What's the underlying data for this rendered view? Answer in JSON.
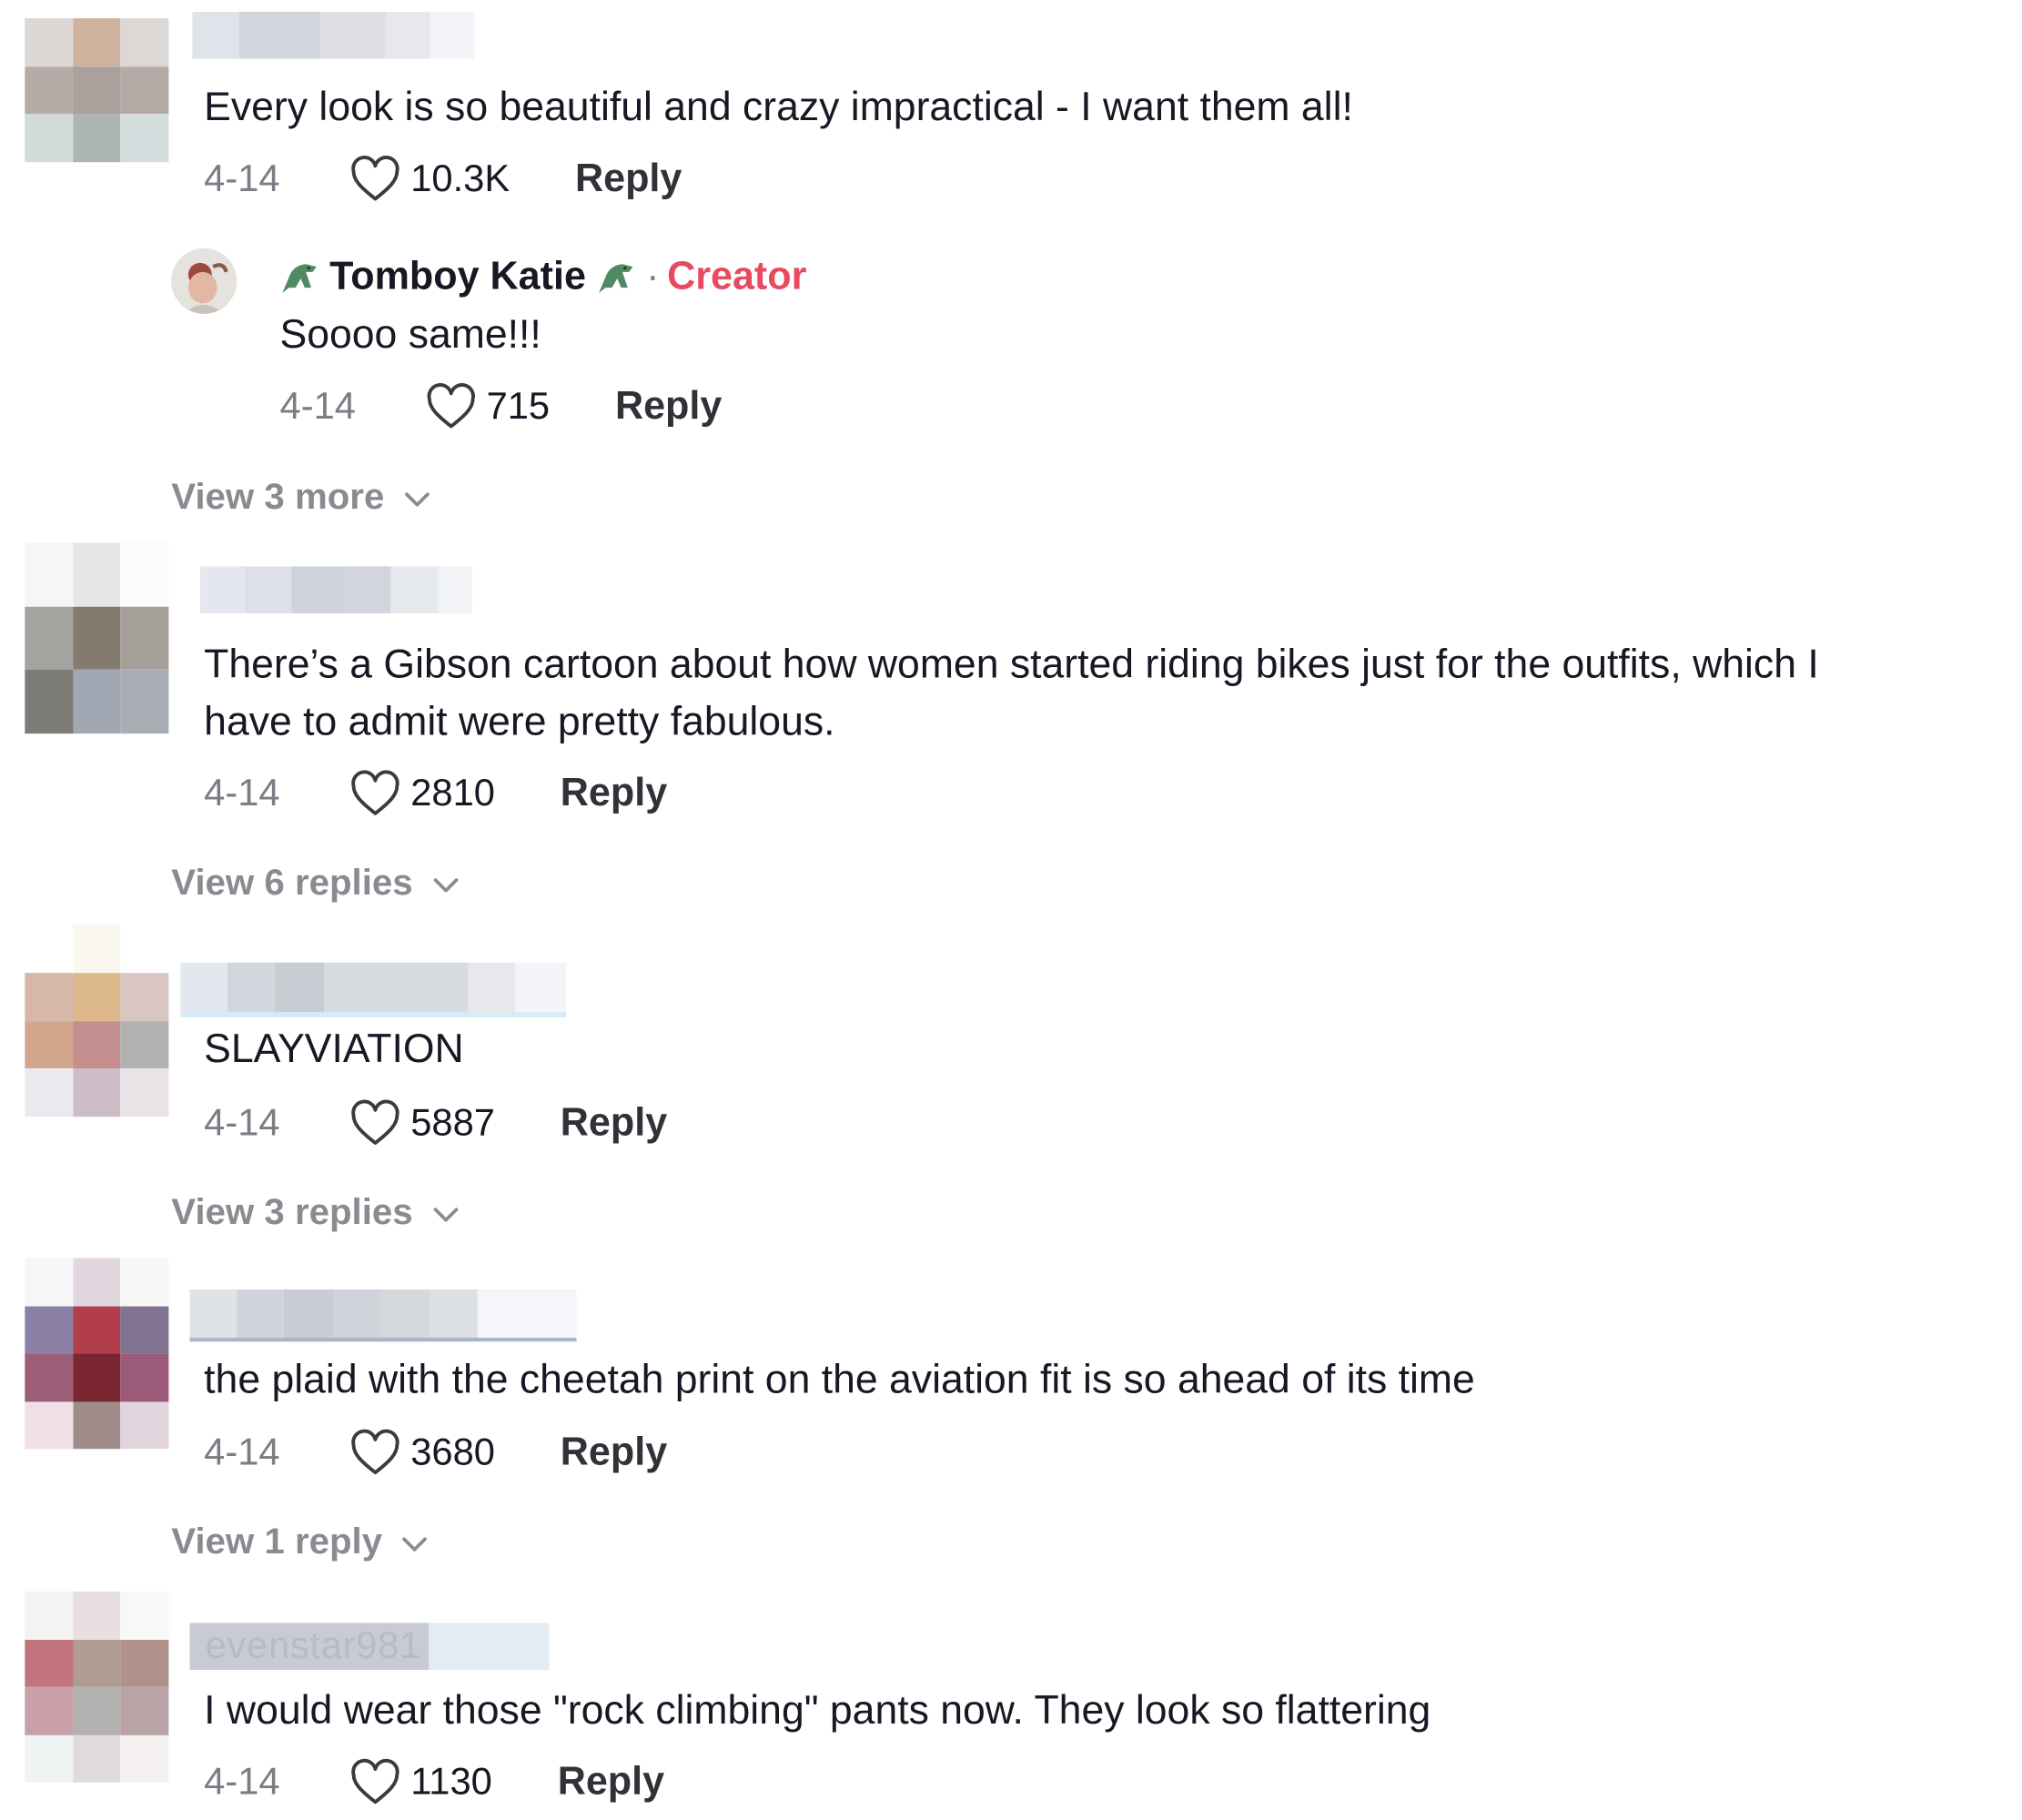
{
  "comments": [
    {
      "username": "",
      "text": "Every look is so beautiful and crazy impractical - I want them all!",
      "date": "4-14",
      "likes": "10.3K",
      "reply_label": "Reply",
      "avatar_colors": [
        "#dcd6d4",
        "#ceb29e",
        "#dcd8d5",
        "#b6aba7",
        "#aba09b",
        "#b6aaa6",
        "#d1dbda",
        "#adb5b2",
        "#d5dedf"
      ],
      "creator_reply": {
        "name": "Tomboy Katie",
        "badge": "Creator",
        "separator": "·",
        "text": "Soooo same!!!",
        "date": "4-14",
        "likes": "715",
        "reply_label": "Reply"
      },
      "view_more": "View 3 more"
    },
    {
      "username": "",
      "text_lines": [
        "There’s a Gibson cartoon about how women started riding bikes just for the outfits, which I",
        "have to admit were pretty fabulous."
      ],
      "date": "4-14",
      "likes": "2810",
      "reply_label": "Reply",
      "avatar_colors": [
        "#f6f6f7",
        "#e7e6e4",
        "#fbfbfb",
        "#a3a39f",
        "#847a6e",
        "#a59f99",
        "#7d7c76",
        "#a1a8b4",
        "#a9adb4"
      ],
      "view_more": "View 6 replies"
    },
    {
      "username": "",
      "text": "SLAYVIATION",
      "date": "4-14",
      "likes": "5887",
      "reply_label": "Reply",
      "avatar_colors": [
        "#d6b7a8",
        "#ddb88a",
        "#dac6c1",
        "#d2a58d",
        "#c58e8e",
        "#b2b1b1",
        "#ece9ee",
        "#ccbcc6",
        "#e9e3e8"
      ],
      "view_more": "View 3 replies"
    },
    {
      "username": "",
      "text": "the plaid with the cheetah print on the aviation fit is so ahead of its time",
      "date": "4-14",
      "likes": "3680",
      "reply_label": "Reply",
      "avatar_colors": [
        "#f6f6f8",
        "#e1d8df",
        "#f8f7f8",
        "#8c80a6",
        "#b13e4a",
        "#807490",
        "#9c5e77",
        "#7a2630",
        "#9b5a7a",
        "#f1dfe6",
        "#a08b8b",
        "#e2d4dc"
      ],
      "view_more": "View 1 reply"
    },
    {
      "username": "evenstar981",
      "text": "I would wear those \"rock climbing\" pants now. They look so flattering",
      "date": "4-14",
      "likes": "1130",
      "reply_label": "Reply",
      "avatar_colors": [
        "#f3f3f4",
        "#e8e0e0",
        "#f8f8f8",
        "#c2737d",
        "#b09c92",
        "#b0928a",
        "#c9a0a8",
        "#b3b0b0",
        "#b9a3a6",
        "#eff3f3",
        "#e1dada",
        "#f3f0ef"
      ]
    }
  ]
}
